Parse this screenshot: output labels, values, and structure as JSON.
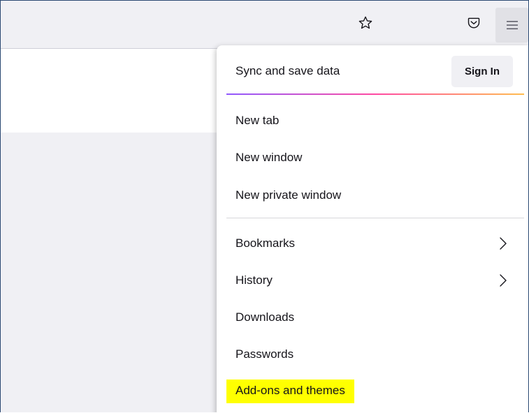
{
  "menu": {
    "sync": {
      "title": "Sync and save data",
      "sign_in": "Sign In"
    },
    "group1": [
      {
        "label": "New tab"
      },
      {
        "label": "New window"
      },
      {
        "label": "New private window"
      }
    ],
    "group2": [
      {
        "label": "Bookmarks",
        "submenu": true
      },
      {
        "label": "History",
        "submenu": true
      },
      {
        "label": "Downloads",
        "submenu": false
      },
      {
        "label": "Passwords",
        "submenu": false
      },
      {
        "label": "Add-ons and themes",
        "submenu": false,
        "highlighted": true
      }
    ]
  },
  "toolbar": {
    "icons": [
      "bookmark-star-icon",
      "pocket-icon",
      "hamburger-menu-icon"
    ]
  },
  "colors": {
    "highlight": "#ffff00",
    "toolbar_bg": "#f0f0f4",
    "gradient": [
      "#9059ff",
      "#ff4aa2",
      "#ffbd4f"
    ]
  }
}
